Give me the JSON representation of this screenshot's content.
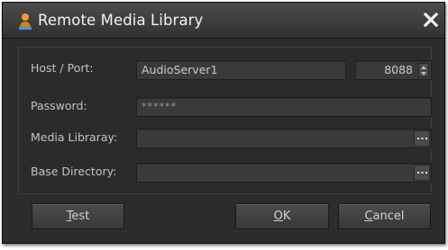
{
  "window": {
    "title": "Remote Media Library",
    "icons": {
      "app": "user-speaker-icon",
      "close": "close-icon"
    }
  },
  "form": {
    "host_label": "Host / Port:",
    "host_value": "AudioServer1",
    "port_value": "8088",
    "password_label": "Password:",
    "password_value": "******",
    "media_library_label": "Media Libraray:",
    "media_library_value": "",
    "base_directory_label": "Base Directory:",
    "base_directory_value": ""
  },
  "buttons": {
    "test": {
      "mnemonic": "T",
      "rest": "est"
    },
    "ok": {
      "mnemonic": "O",
      "rest": "K"
    },
    "cancel": {
      "mnemonic": "C",
      "rest": "ancel"
    }
  },
  "colors": {
    "window_bg": "#2c2c2c",
    "field_bg": "#3a3a3a",
    "text": "#c3c3c3",
    "icon_accent": "#e8a32a"
  }
}
